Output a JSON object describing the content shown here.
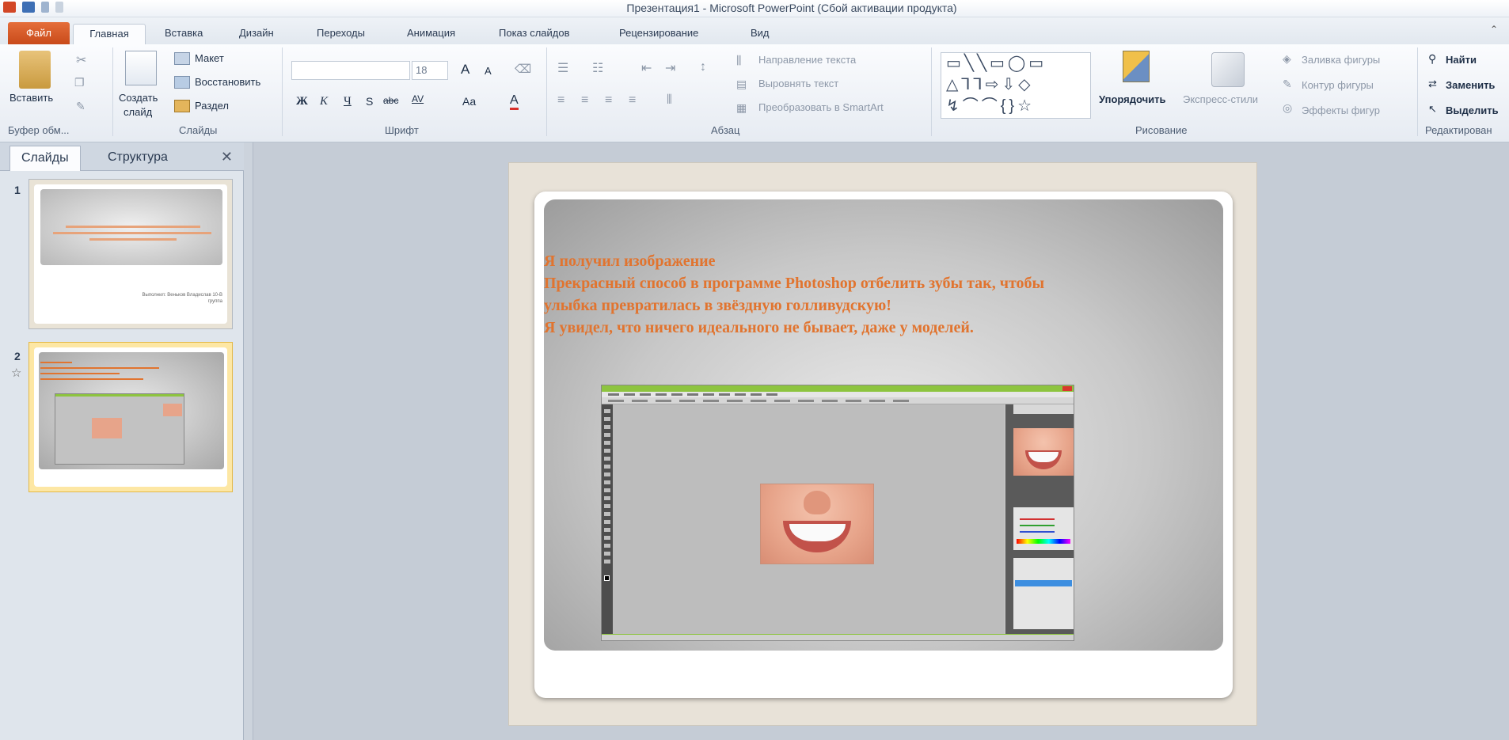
{
  "window": {
    "title": "Презентация1 - Microsoft PowerPoint (Сбой активации продукта)"
  },
  "tabs": [
    {
      "label": "Файл"
    },
    {
      "label": "Главная"
    },
    {
      "label": "Вставка"
    },
    {
      "label": "Дизайн"
    },
    {
      "label": "Переходы"
    },
    {
      "label": "Анимация"
    },
    {
      "label": "Показ слайдов"
    },
    {
      "label": "Рецензирование"
    },
    {
      "label": "Вид"
    }
  ],
  "ribbon": {
    "clipboard": {
      "paste": "Вставить",
      "group": "Буфер обм..."
    },
    "slides": {
      "create": "Создать",
      "create2": "слайд",
      "layout": "Макет",
      "reset": "Восстановить",
      "section": "Раздел",
      "group": "Слайды"
    },
    "font": {
      "size": "18",
      "group": "Шрифт",
      "bold": "Ж",
      "italic": "К",
      "underline": "Ч",
      "strike": "S",
      "shadow": "abc",
      "spacing": "AV",
      "case": "Aa",
      "color": "A"
    },
    "paragraph": {
      "direction": "Направление текста",
      "align": "Выровнять текст",
      "smartart": "Преобразовать в SmartArt",
      "group": "Абзац"
    },
    "drawing": {
      "arrange": "Упорядочить",
      "quick_styles": "Экспресс-стили",
      "fill": "Заливка фигуры",
      "outline": "Контур фигуры",
      "effects": "Эффекты фигур",
      "group": "Рисование"
    },
    "editing": {
      "find": "Найти",
      "replace": "Заменить",
      "select": "Выделить",
      "group": "Редактирован"
    }
  },
  "left_pane": {
    "tab_slides": "Слайды",
    "tab_outline": "Структура",
    "close": "✕",
    "slides": [
      {
        "number": "1",
        "author": "Выполнил: Веньков Владислав 10-В группа"
      },
      {
        "number": "2"
      }
    ]
  },
  "slide": {
    "lines": [
      "Я получил изображение",
      "Прекрасный способ в программе Photoshop отбелить зубы так, чтобы",
      "улыбка превратилась в звёздную голливудскую!",
      "Я увидел, что ничего идеального не бывает, даже у моделей."
    ]
  },
  "colors": {
    "file_tab": "#d05a24",
    "slide_text": "#e1742f",
    "selection": "#fde7a4"
  }
}
